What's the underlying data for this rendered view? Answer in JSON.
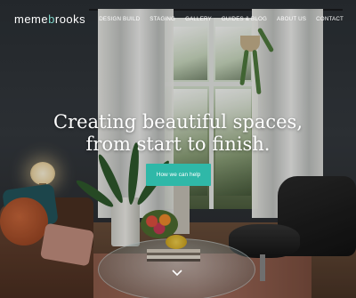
{
  "brand": {
    "logo_part1": "meme",
    "logo_part2": "b",
    "logo_part3": "rooks"
  },
  "nav": {
    "items": [
      {
        "label": "DESIGN BUILD"
      },
      {
        "label": "STAGING"
      },
      {
        "label": "GALLERY"
      },
      {
        "label": "GUIDES & BLOG"
      },
      {
        "label": "ABOUT US"
      },
      {
        "label": "CONTACT"
      }
    ]
  },
  "hero": {
    "headline_line1": "Creating beautiful spaces,",
    "headline_line2": "from start to finish.",
    "cta_label": "How we can help"
  },
  "colors": {
    "accent": "#2fb8a8",
    "logo_accent": "#7cd3c7",
    "text": "#ffffff"
  },
  "icons": {
    "scroll": "chevron-down-icon"
  }
}
